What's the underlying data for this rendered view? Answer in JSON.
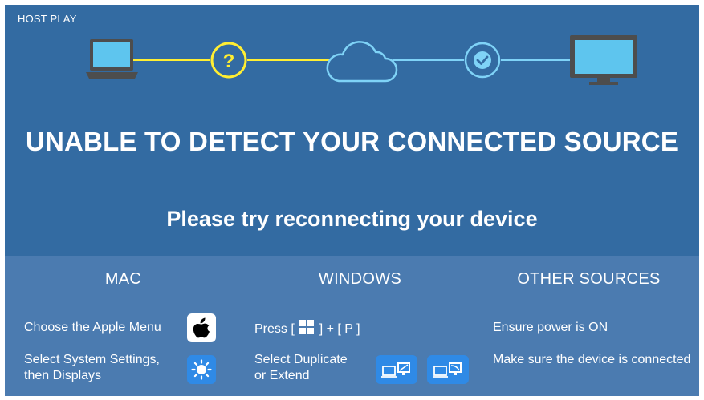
{
  "header": {
    "label": "HOST PLAY"
  },
  "diagram": {
    "steps": [
      {
        "icon": "laptop-icon",
        "status": "source"
      },
      {
        "icon": "question-icon",
        "status": "unknown"
      },
      {
        "icon": "cloud-icon",
        "status": "network"
      },
      {
        "icon": "check-icon",
        "status": "ok"
      },
      {
        "icon": "monitor-icon",
        "status": "display"
      }
    ],
    "colors": {
      "problem": "#ffee33",
      "ok": "#7fd3f7"
    }
  },
  "message": {
    "headline": "UNABLE TO DETECT YOUR CONNECTED SOURCE",
    "subline": "Please try reconnecting your device"
  },
  "mac": {
    "title": "MAC",
    "step1": "Choose the Apple Menu",
    "step2_line1": "Select System Settings,",
    "step2_line2": "then Displays"
  },
  "windows": {
    "title": "WINDOWS",
    "press_prefix": "Press [",
    "press_suffix": "] + [ P ]",
    "step2_line1": "Select Duplicate",
    "step2_line2": "or Extend"
  },
  "other": {
    "title": "OTHER SOURCES",
    "step1": "Ensure power is ON",
    "step2": "Make sure the device is connected"
  }
}
